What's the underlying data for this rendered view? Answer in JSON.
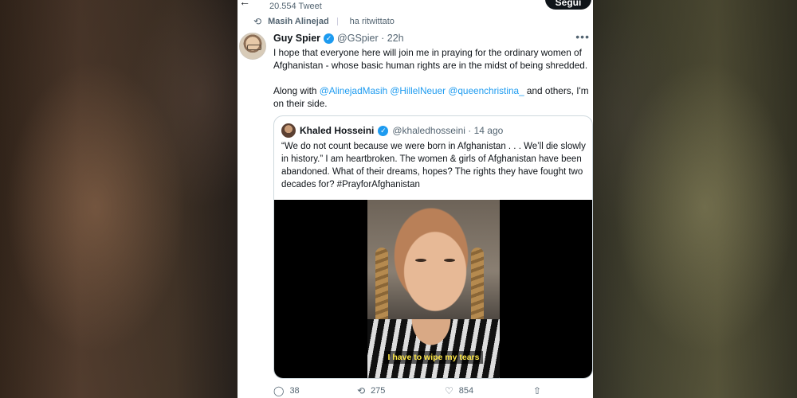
{
  "header": {
    "tweet_count": "20.554 Tweet",
    "follow_label": "Segui"
  },
  "retweet": {
    "user": "Masih Alinejad",
    "label": "ha ritwittato"
  },
  "tweet": {
    "author_name": "Guy Spier",
    "handle_time": "@GSpier · 22h",
    "text_1": "I hope that everyone here will join me in praying for the ordinary women of Afghanistan - whose basic human rights are in the midst of being shredded.",
    "text_2_prefix": "Along with ",
    "mentions": [
      "@AlinejadMasih",
      "@HillelNeuer",
      "@queenchristina_"
    ],
    "text_2_suffix": " and others, I'm on their side."
  },
  "quote": {
    "author_name": "Khaled Hosseini",
    "handle_time": "@khaledhosseini · 14 ago",
    "text": "“We do not count because we were born in Afghanistan . . . We’ll die slowly in history.” I am heartbroken. The women & girls of Afghanistan have been abandoned. What of their dreams, hopes? The rights they have fought two decades for? #PrayforAfghanistan",
    "video_subtitle": "I have to wipe my tears"
  },
  "actions": {
    "replies": "38",
    "retweets": "275",
    "likes": "854"
  },
  "colors": {
    "accent": "#1d9bf0",
    "text": "#0f1419",
    "muted": "#536471"
  },
  "icons": [
    "back-arrow-icon",
    "retweet-icon",
    "verified-icon",
    "more-icon",
    "reply-icon",
    "like-icon",
    "share-icon"
  ]
}
